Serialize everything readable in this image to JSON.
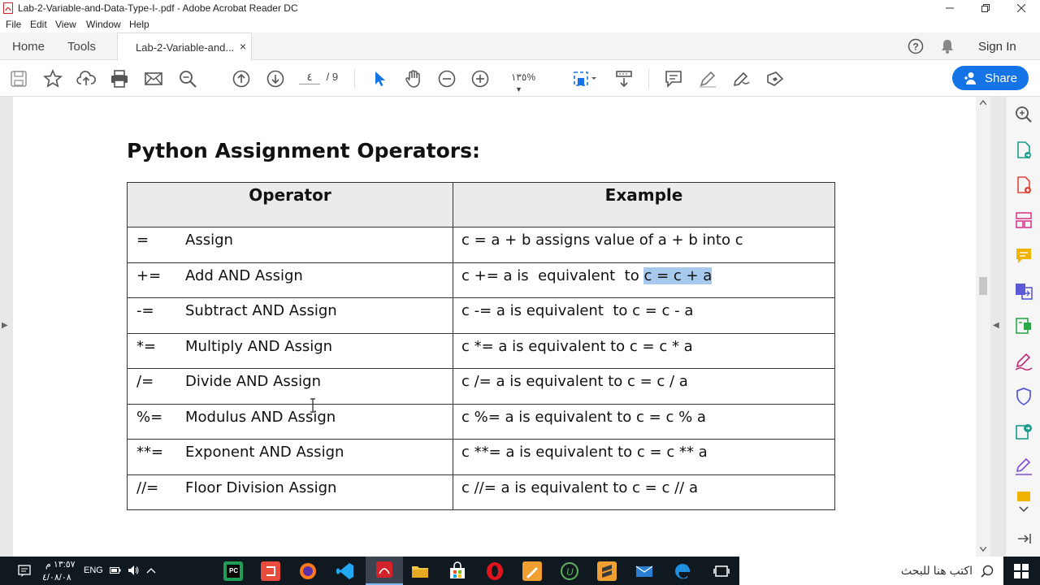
{
  "window": {
    "title": "Lab-2-Variable-and-Data-Type-I-.pdf - Adobe Acrobat Reader DC",
    "controls": [
      "minimize",
      "restore",
      "close"
    ]
  },
  "menu": [
    "File",
    "Edit",
    "View",
    "Window",
    "Help"
  ],
  "tabs": {
    "home": "Home",
    "tools": "Tools",
    "document": "Lab-2-Variable-and...",
    "close": "×"
  },
  "header_right": {
    "sign_in": "Sign In"
  },
  "toolbar": {
    "page_current": "٤",
    "page_total": "/ 9",
    "zoom": "١٣٥%",
    "share": "Share"
  },
  "document": {
    "heading": "Python Assignment Operators:",
    "columns": [
      "Operator",
      "Example"
    ],
    "rows": [
      {
        "symbol": "=",
        "name": "Assign",
        "example": "c = a + b  assigns  value of a + b into c"
      },
      {
        "symbol": "+=",
        "name": "Add AND Assign",
        "example_prefix": "c += a is  equivalent  to ",
        "example_highlight": "c = c + a"
      },
      {
        "symbol": "-=",
        "name": "Subtract AND Assign",
        "example": "c -= a is equivalent  to c = c - a"
      },
      {
        "symbol": "*=",
        "name": "Multiply AND Assign",
        "example": "c *= a is equivalent to c = c * a"
      },
      {
        "symbol": "/=",
        "name": "Divide AND Assign",
        "example": "c /= a is equivalent to c = c / a"
      },
      {
        "symbol": "%=",
        "name": "Modulus AND Assign",
        "example": "c %= a is equivalent to c = c % a"
      },
      {
        "symbol": "**=",
        "name": "Exponent AND Assign",
        "example": "c **= a is equivalent to c = c ** a"
      },
      {
        "symbol": "//=",
        "name": "Floor Division Assign",
        "example": "c //= a is equivalent to c = c // a"
      }
    ]
  },
  "taskbar": {
    "search_placeholder": "اكتب هنا للبحث",
    "time": "١٣:٥٧ م",
    "date": "٤/٠٨/٠٨",
    "lang": "ENG"
  },
  "colors": {
    "accent": "#1473e6",
    "highlight": "#a8c9ee",
    "acrobat_red": "#d2232a",
    "taskbar": "#101820"
  }
}
